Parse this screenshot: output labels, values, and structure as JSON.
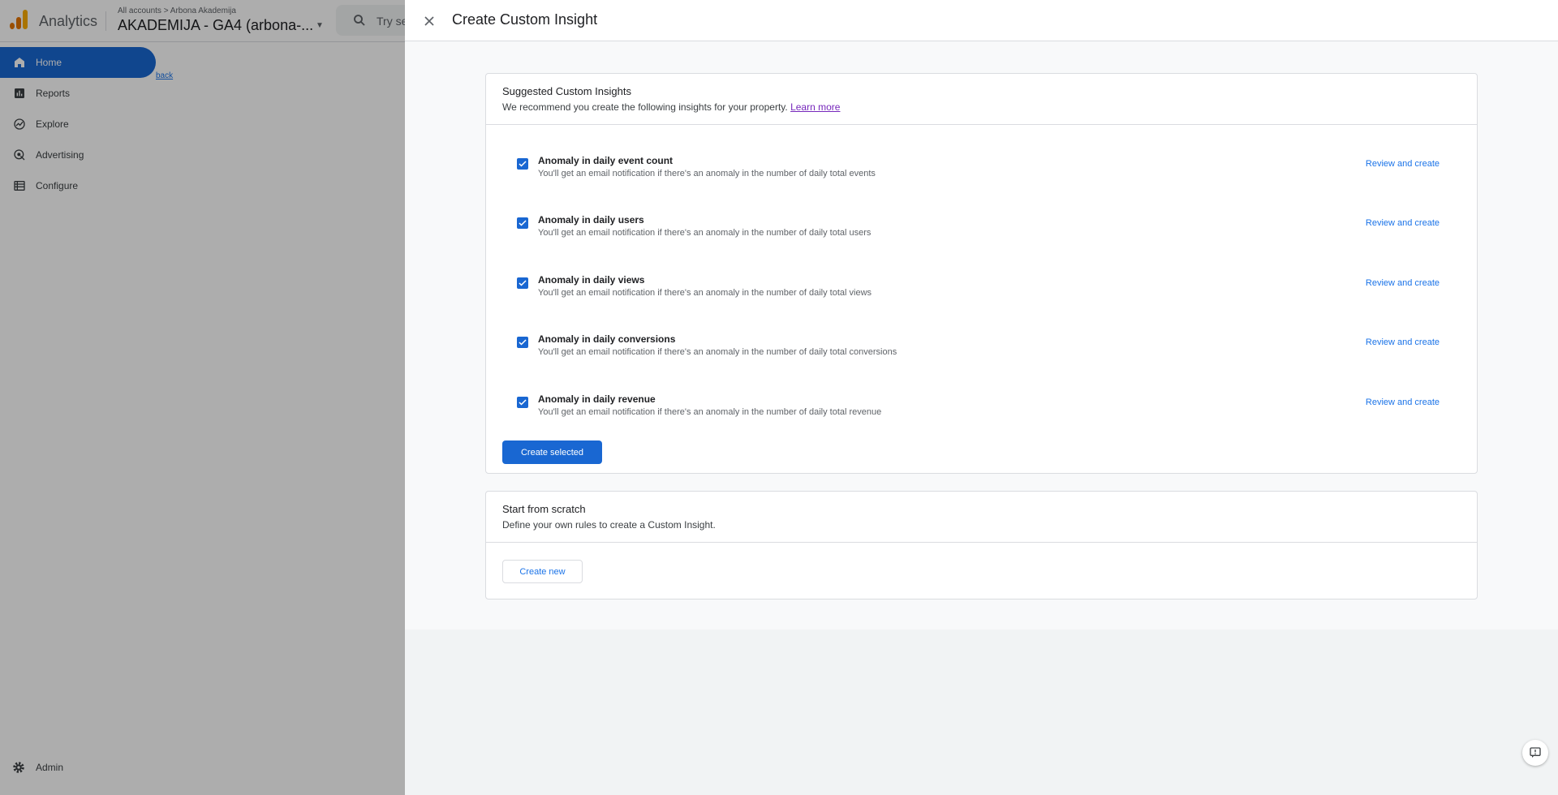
{
  "app": {
    "name": "Analytics",
    "breadcrumb_account": "All accounts",
    "breadcrumb_sep": ">",
    "breadcrumb_sub": "Arbona Akademija",
    "property_name": "AKADEMIJA - GA4 (arbona-...",
    "search_placeholder": "Try se"
  },
  "sidebar": {
    "items": [
      {
        "label": "Home",
        "icon": "home-icon"
      },
      {
        "label": "Reports",
        "icon": "bar-chart-icon"
      },
      {
        "label": "Explore",
        "icon": "explore-icon"
      },
      {
        "label": "Advertising",
        "icon": "advertising-icon"
      },
      {
        "label": "Configure",
        "icon": "list-icon"
      }
    ],
    "admin_label": "Admin",
    "back_link": "back"
  },
  "panel": {
    "title": "Create Custom Insight",
    "suggested": {
      "title": "Suggested Custom Insights",
      "subtitle": "We recommend you create the following insights for your property.",
      "learn_more": "Learn more",
      "items": [
        {
          "title": "Anomaly in daily event count",
          "desc": "You'll get an email notification if there's an anomaly in the number of daily total events",
          "action": "Review and create",
          "checked": true
        },
        {
          "title": "Anomaly in daily users",
          "desc": "You'll get an email notification if there's an anomaly in the number of daily total users",
          "action": "Review and create",
          "checked": true
        },
        {
          "title": "Anomaly in daily views",
          "desc": "You'll get an email notification if there's an anomaly in the number of daily total views",
          "action": "Review and create",
          "checked": true
        },
        {
          "title": "Anomaly in daily conversions",
          "desc": "You'll get an email notification if there's an anomaly in the number of daily total conversions",
          "action": "Review and create",
          "checked": true
        },
        {
          "title": "Anomaly in daily revenue",
          "desc": "You'll get an email notification if there's an anomaly in the number of daily total revenue",
          "action": "Review and create",
          "checked": true
        }
      ],
      "create_selected": "Create selected"
    },
    "scratch": {
      "title": "Start from scratch",
      "subtitle": "Define your own rules to create a Custom Insight.",
      "create_new": "Create new"
    }
  },
  "colors": {
    "primary": "#1967d2",
    "link": "#1a73e8",
    "visited_link": "#7627bb",
    "analytics_orange": "#e37400",
    "analytics_yellow": "#f9ab00"
  }
}
